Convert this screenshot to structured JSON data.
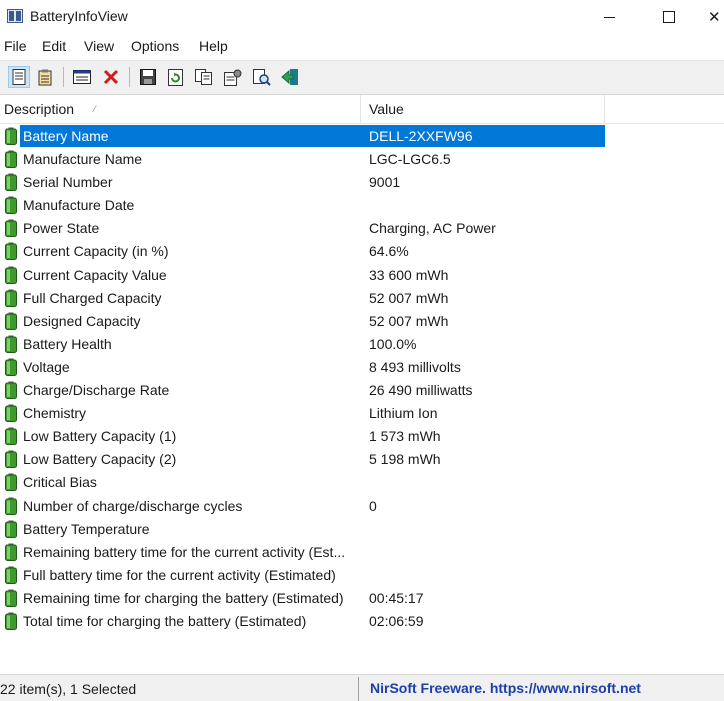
{
  "window": {
    "title": "BatteryInfoView"
  },
  "menu": [
    "File",
    "Edit",
    "View",
    "Options",
    "Help"
  ],
  "toolbar": {
    "buttons": [
      "properties-icon",
      "clipboard-list-icon",
      "html-report-icon",
      "delete-icon",
      "save-icon",
      "refresh-icon",
      "copy-icon",
      "options-icon",
      "find-icon",
      "exit-icon"
    ]
  },
  "list": {
    "columns": [
      "Description",
      "Value"
    ],
    "rows": [
      {
        "name": "Battery Name",
        "value": "DELL-2XXFW96",
        "selected": true
      },
      {
        "name": "Manufacture Name",
        "value": "LGC-LGC6.5"
      },
      {
        "name": "Serial Number",
        "value": "9001"
      },
      {
        "name": "Manufacture Date",
        "value": ""
      },
      {
        "name": "Power State",
        "value": "Charging, AC Power"
      },
      {
        "name": "Current Capacity (in %)",
        "value": "64.6%"
      },
      {
        "name": "Current Capacity Value",
        "value": "33 600 mWh"
      },
      {
        "name": "Full Charged Capacity",
        "value": "52 007 mWh"
      },
      {
        "name": "Designed Capacity",
        "value": "52 007 mWh"
      },
      {
        "name": "Battery Health",
        "value": "100.0%"
      },
      {
        "name": "Voltage",
        "value": "8 493 millivolts"
      },
      {
        "name": "Charge/Discharge Rate",
        "value": "26 490 milliwatts"
      },
      {
        "name": "Chemistry",
        "value": "Lithium Ion"
      },
      {
        "name": "Low Battery Capacity (1)",
        "value": "1 573 mWh"
      },
      {
        "name": "Low Battery Capacity (2)",
        "value": "5 198 mWh"
      },
      {
        "name": "Critical Bias",
        "value": ""
      },
      {
        "name": "Number of charge/discharge cycles",
        "value": "0"
      },
      {
        "name": "Battery Temperature",
        "value": ""
      },
      {
        "name": "Remaining battery time for the current activity (Est...",
        "value": ""
      },
      {
        "name": "Full battery time for the current activity (Estimated)",
        "value": ""
      },
      {
        "name": "Remaining time for charging the battery (Estimated)",
        "value": "00:45:17"
      },
      {
        "name": "Total  time for charging the battery (Estimated)",
        "value": "02:06:59"
      }
    ]
  },
  "status": {
    "items": "22 item(s), 1 Selected",
    "link": "NirSoft Freeware. https://www.nirsoft.net"
  },
  "colors": {
    "selection": "#0078d7",
    "link": "#1c3faa",
    "battery_green": "#3f9a2e"
  }
}
